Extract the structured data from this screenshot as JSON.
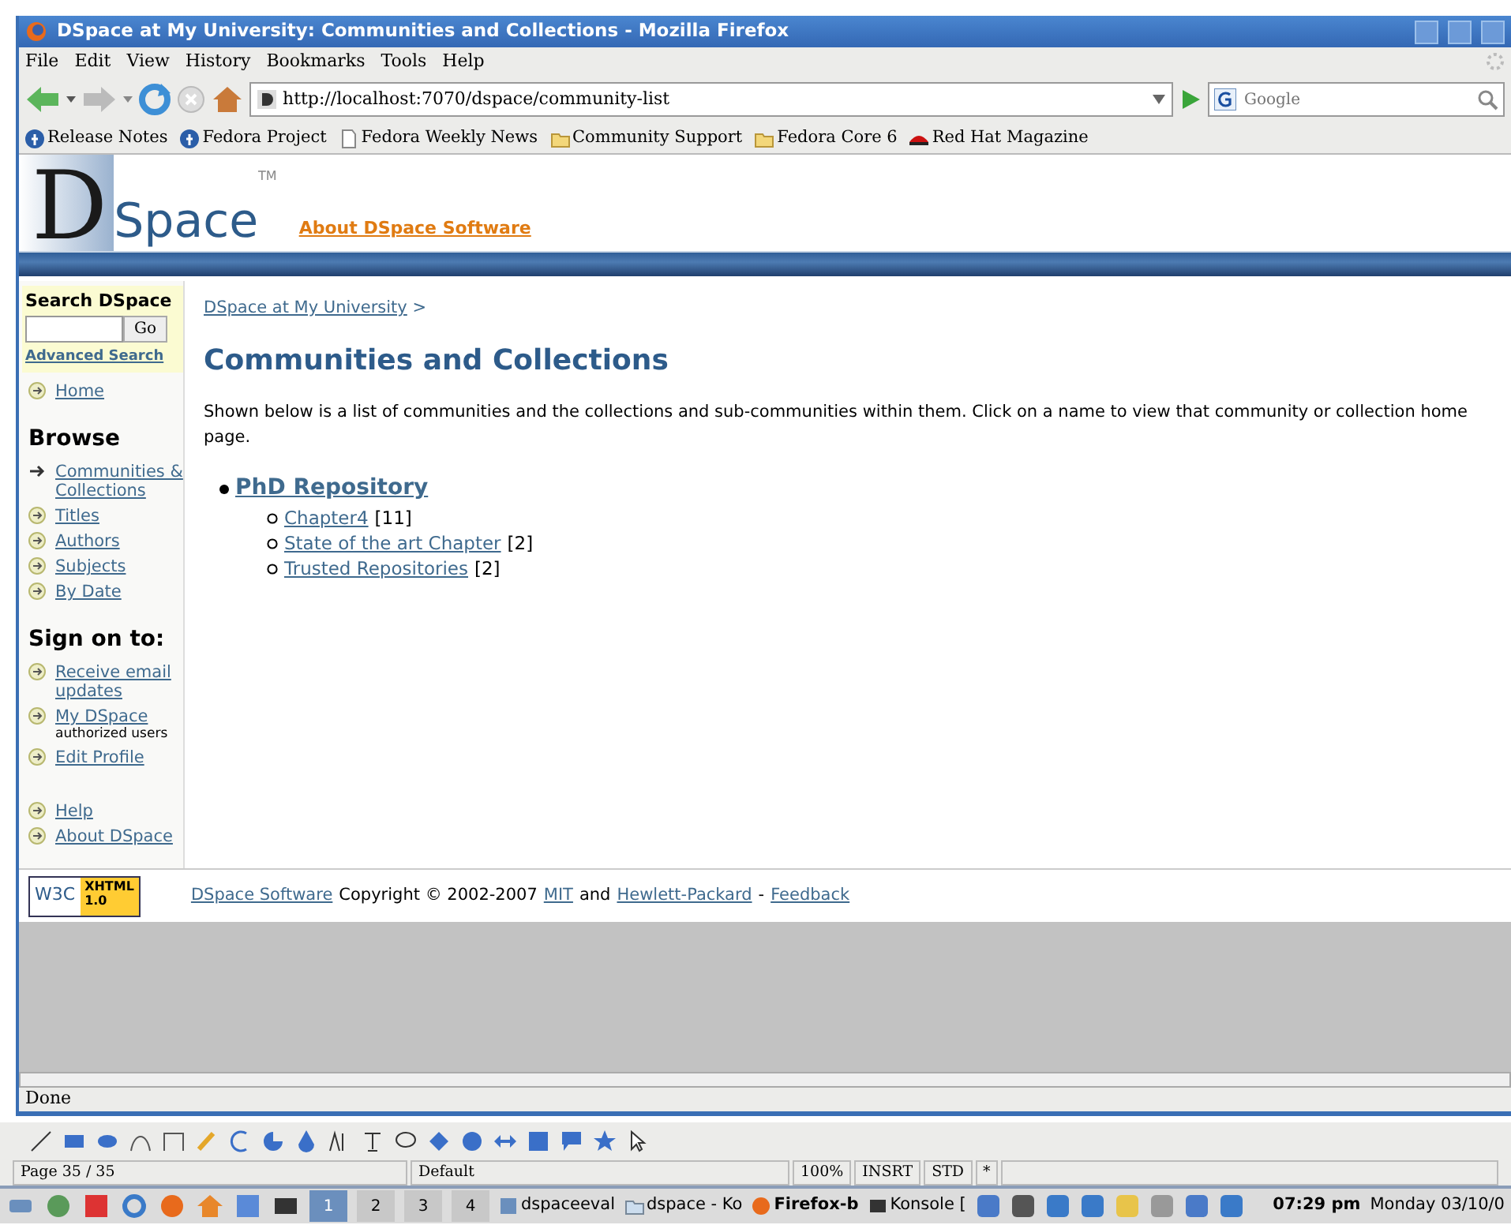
{
  "window": {
    "title": "DSpace at My University: Communities and Collections - Mozilla Firefox"
  },
  "menu": [
    "File",
    "Edit",
    "View",
    "History",
    "Bookmarks",
    "Tools",
    "Help"
  ],
  "address": {
    "value": "http://localhost:7070/dspace/community-list"
  },
  "search": {
    "placeholder": "Google"
  },
  "bookmarks": [
    {
      "label": "Release Notes",
      "kind": "fedora"
    },
    {
      "label": "Fedora Project",
      "kind": "fedora"
    },
    {
      "label": "Fedora Weekly News",
      "kind": "page"
    },
    {
      "label": "Community Support",
      "kind": "folder"
    },
    {
      "label": "Fedora Core 6",
      "kind": "folder"
    },
    {
      "label": "Red Hat Magazine",
      "kind": "redhat"
    }
  ],
  "page": {
    "logo": {
      "letter": "D",
      "word": "Space",
      "tm": "TM"
    },
    "about_link": "About DSpace Software",
    "sidebar": {
      "search_title": "Search DSpace",
      "go": "Go",
      "advanced": "Advanced Search",
      "home": "Home",
      "browse_title": "Browse",
      "browse": [
        {
          "label": "Communities & Collections",
          "selected": true
        },
        {
          "label": "Titles",
          "selected": false
        },
        {
          "label": "Authors",
          "selected": false
        },
        {
          "label": "Subjects",
          "selected": false
        },
        {
          "label": "By Date",
          "selected": false
        }
      ],
      "sign_title": "Sign on to:",
      "sign": [
        {
          "label": "Receive email updates"
        },
        {
          "label": "My DSpace",
          "note": "authorized users"
        },
        {
          "label": "Edit Profile"
        }
      ],
      "more": [
        "Help",
        "About DSpace"
      ]
    },
    "breadcrumb": {
      "link": "DSpace at My University",
      "separator": ">"
    },
    "heading": "Communities and Collections",
    "intro": "Shown below is a list of communities and the collections and sub-communities within them. Click on a name to view that community or collection home page.",
    "communities": [
      {
        "name": "PhD Repository",
        "collections": [
          {
            "name": "Chapter4",
            "count": "[11]"
          },
          {
            "name": "State of the art Chapter",
            "count": "[2]"
          },
          {
            "name": "Trusted Repositories",
            "count": "[2]"
          }
        ]
      }
    ],
    "footer": {
      "badge": {
        "w3c": "W3C",
        "xhtml": "XHTML",
        "version": "1.0"
      },
      "parts": [
        {
          "kind": "link",
          "text": "DSpace Software"
        },
        {
          "kind": "text",
          "text": "Copyright © 2002-2007"
        },
        {
          "kind": "link",
          "text": "MIT"
        },
        {
          "kind": "text",
          "text": "and"
        },
        {
          "kind": "link",
          "text": "Hewlett-Packard"
        },
        {
          "kind": "text",
          "text": "-"
        },
        {
          "kind": "link",
          "text": "Feedback"
        }
      ]
    }
  },
  "status": "Done",
  "office": {
    "status": [
      "Page 35 / 35",
      "Default",
      "100%",
      "INSRT",
      "STD",
      "*"
    ]
  },
  "taskbar": {
    "desktops": [
      {
        "label": "1",
        "selected": true
      },
      {
        "label": "2",
        "selected": false
      },
      {
        "label": "3",
        "selected": false
      },
      {
        "label": "4",
        "selected": false
      }
    ],
    "tasks": [
      {
        "label": "dspaceeval",
        "kind": "app"
      },
      {
        "label": "dspace - Ko",
        "kind": "folder"
      },
      {
        "label": "Firefox-b",
        "kind": "firefox"
      },
      {
        "label": "Konsole [",
        "kind": "terminal"
      }
    ],
    "time": "07:29 pm",
    "date": "Monday 03/10/0"
  }
}
